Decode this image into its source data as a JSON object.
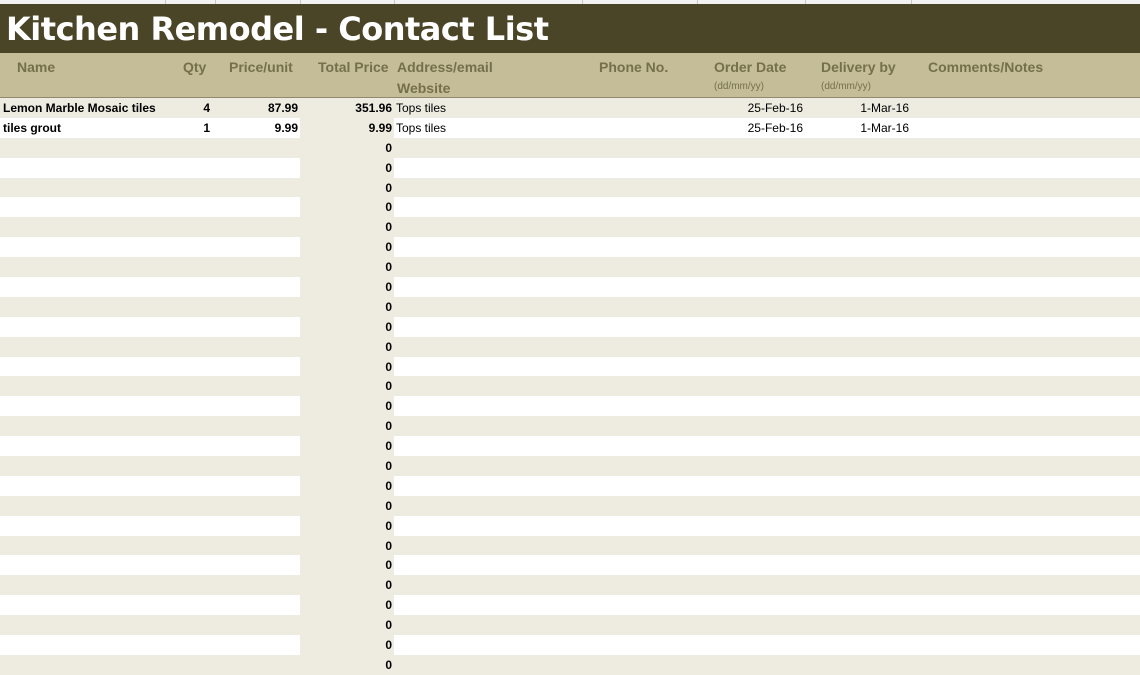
{
  "title": "Kitchen Remodel - Contact List",
  "headers": {
    "name": "Name",
    "qty": "Qty",
    "price_unit": "Price/unit",
    "total_price": "Total Price",
    "address": "Address/email",
    "website": "Website",
    "phone": "Phone No.",
    "order_date": "Order Date",
    "order_date_fmt": "(dd/mm/yy)",
    "delivery": "Delivery by",
    "delivery_fmt": "(dd/mm/yy)",
    "comments": "Comments/Notes"
  },
  "items": [
    {
      "name": "Lemon Marble Mosaic tiles",
      "qty": "4",
      "price_unit": "87.99",
      "total": "351.96",
      "address": "Tops tiles",
      "order_date": "25-Feb-16",
      "delivery": "1-Mar-16"
    },
    {
      "name": "tiles grout",
      "qty": "1",
      "price_unit": "9.99",
      "total": "9.99",
      "address": "Tops tiles",
      "order_date": "25-Feb-16",
      "delivery": "1-Mar-16"
    }
  ],
  "empty_total": "0",
  "empty_row_count": 27,
  "colors": {
    "title_bg": "#4b4528",
    "header_bg": "#c4bd97",
    "header_text": "#75704b",
    "band": "#eeece1"
  }
}
